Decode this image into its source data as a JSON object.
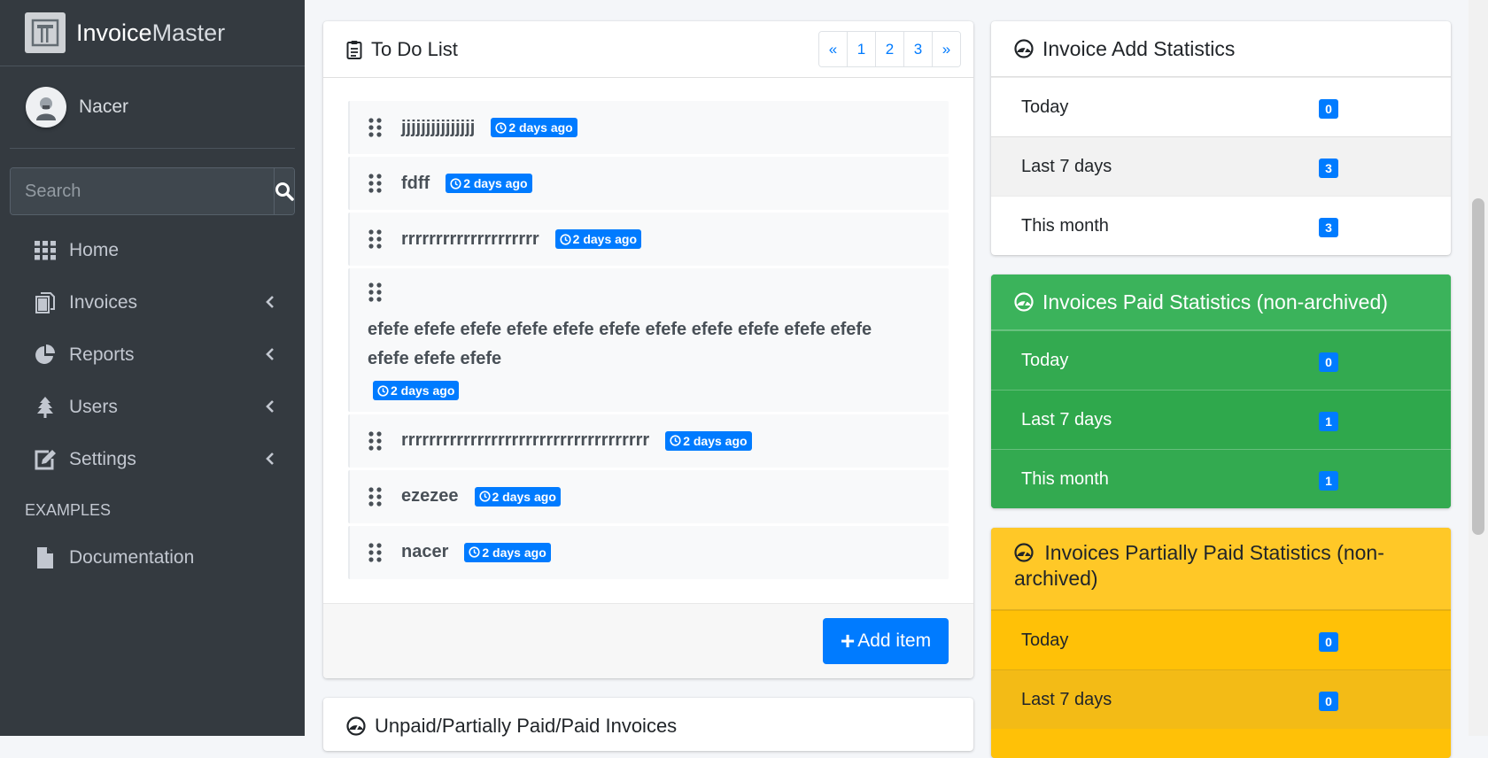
{
  "brand": {
    "bold": "Invoice",
    "light": "Master"
  },
  "user": {
    "name": "Nacer"
  },
  "search": {
    "placeholder": "Search"
  },
  "nav": {
    "items": [
      {
        "label": "Home",
        "icon": "grid-icon"
      },
      {
        "label": "Invoices",
        "icon": "copy-icon"
      },
      {
        "label": "Reports",
        "icon": "pie-chart-icon"
      },
      {
        "label": "Users",
        "icon": "tree-icon"
      },
      {
        "label": "Settings",
        "icon": "edit-icon"
      }
    ],
    "header": "EXAMPLES",
    "docs": {
      "label": "Documentation",
      "icon": "file-icon"
    }
  },
  "todo": {
    "title": "To Do List",
    "pager": [
      "«",
      "1",
      "2",
      "3",
      "»"
    ],
    "items": [
      {
        "text": "jjjjjjjjjjjjjjj",
        "time": "2 days ago"
      },
      {
        "text": "fdff",
        "time": "2 days ago"
      },
      {
        "text": "rrrrrrrrrrrrrrrrrrrr",
        "time": "2 days ago"
      },
      {
        "text": "efefe efefe efefe efefe efefe efefe efefe efefe efefe efefe efefe efefe efefe efefe",
        "time": "2 days ago"
      },
      {
        "text": "rrrrrrrrrrrrrrrrrrrrrrrrrrrrrrrrrrrr",
        "time": "2 days ago"
      },
      {
        "text": "ezezee",
        "time": "2 days ago"
      },
      {
        "text": "nacer",
        "time": "2 days ago"
      }
    ],
    "add_label": "Add item"
  },
  "invoices_card": {
    "title": "Unpaid/Partially Paid/Paid Invoices"
  },
  "stats": {
    "add": {
      "title": "Invoice Add Statistics",
      "rows": [
        {
          "label": "Today",
          "value": "0"
        },
        {
          "label": "Last 7 days",
          "value": "3"
        },
        {
          "label": "This month",
          "value": "3"
        }
      ]
    },
    "paid": {
      "title": "Invoices Paid Statistics (non-archived)",
      "rows": [
        {
          "label": "Today",
          "value": "0"
        },
        {
          "label": "Last 7 days",
          "value": "1"
        },
        {
          "label": "This month",
          "value": "1"
        }
      ]
    },
    "partial": {
      "title": "Invoices Partially Paid Statistics (non-archived)",
      "rows": [
        {
          "label": "Today",
          "value": "0"
        },
        {
          "label": "Last 7 days",
          "value": "0"
        }
      ]
    }
  },
  "colors": {
    "sidebar": "#343a40",
    "primary": "#007bff",
    "success": "#28a745",
    "warning": "#ffc107"
  }
}
